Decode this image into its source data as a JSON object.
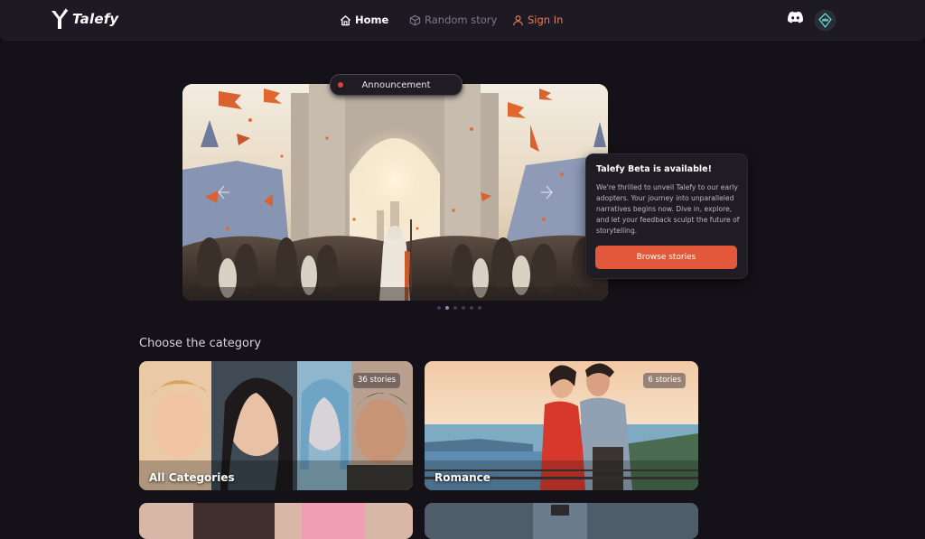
{
  "brand": {
    "name": "Talefy"
  },
  "nav": {
    "home": "Home",
    "random": "Random story",
    "signin": "Sign In"
  },
  "hero": {
    "badge": "Announcement",
    "title": "Talefy Beta is available!",
    "body": "We're thrilled to unveil Talefy to our early adopters. Your journey into unparalleled narratives begins now. Dive in, explore, and let your feedback sculpt the future of storytelling.",
    "button": "Browse stories",
    "slides_total": 6,
    "slide_active": 2
  },
  "categories": {
    "title": "Choose the category",
    "items": [
      {
        "name": "All Categories",
        "count": "36 stories"
      },
      {
        "name": "Romance",
        "count": "6 stories"
      }
    ]
  },
  "colors": {
    "accent": "#e1593a",
    "signin": "#f07a44",
    "background": "#141118"
  }
}
